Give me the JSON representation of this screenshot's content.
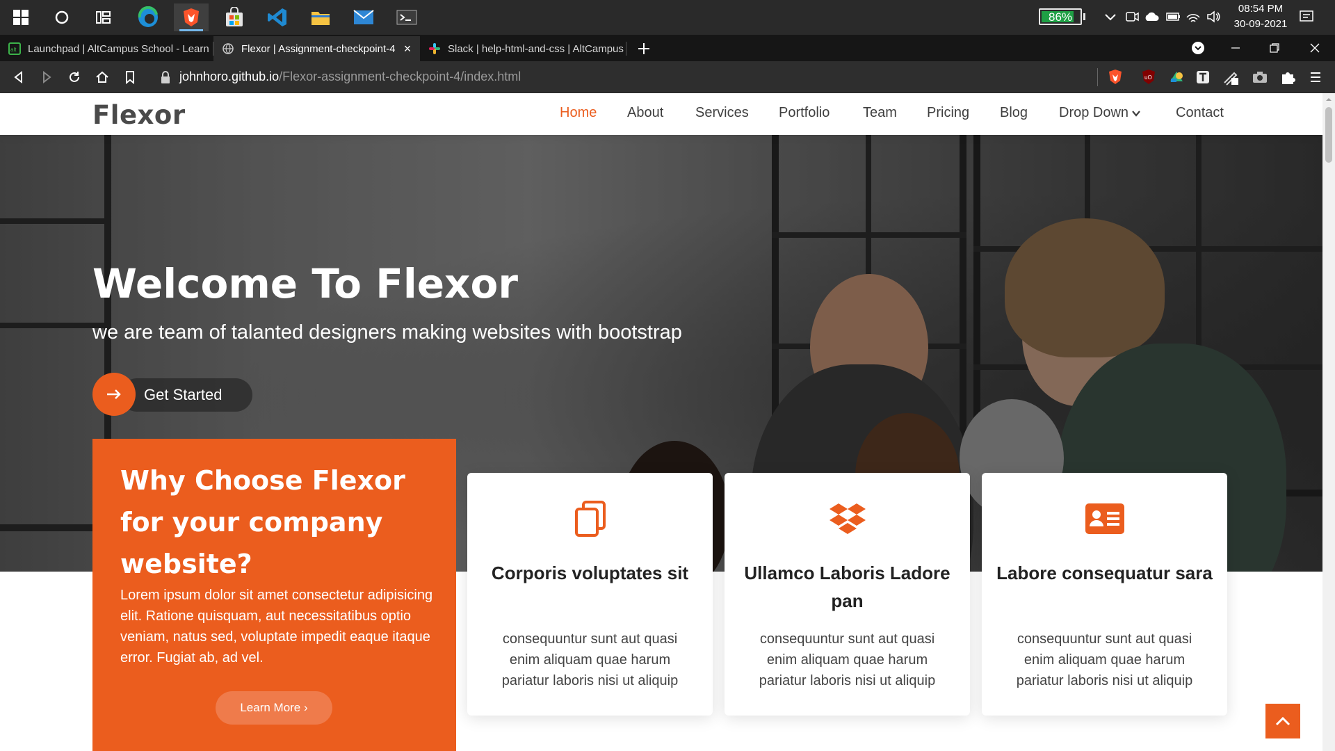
{
  "taskbar": {
    "apps": [
      {
        "name": "windows-start"
      },
      {
        "name": "cortana-search"
      },
      {
        "name": "task-view"
      },
      {
        "name": "edge"
      },
      {
        "name": "brave"
      },
      {
        "name": "microsoft-store"
      },
      {
        "name": "vscode"
      },
      {
        "name": "file-explorer"
      },
      {
        "name": "mail"
      },
      {
        "name": "terminal"
      }
    ],
    "battery_percent": 0.86,
    "battery_label": "86%",
    "clock_time": "08:54 PM",
    "clock_date": "30-09-2021"
  },
  "browser": {
    "tabs": [
      {
        "title": "Launchpad | AltCampus School - Learn",
        "favicon": "altcampus-icon",
        "active": false
      },
      {
        "title": "Flexor | Assignment-checkpoint-4",
        "favicon": "globe-icon",
        "active": true
      },
      {
        "title": "Slack | help-html-and-css | AltCampus",
        "favicon": "slack-icon",
        "active": false
      }
    ],
    "url_host": "johnhoro.github.io",
    "url_path": "/Flexor-assignment-checkpoint-4/index.html"
  },
  "site": {
    "logo": "Flexor",
    "nav": [
      {
        "label": "Home",
        "active": true
      },
      {
        "label": "About"
      },
      {
        "label": "Services"
      },
      {
        "label": "Portfolio"
      },
      {
        "label": "Team"
      },
      {
        "label": "Pricing"
      },
      {
        "label": "Blog"
      },
      {
        "label": "Drop Down"
      },
      {
        "label": "Contact"
      }
    ],
    "hero": {
      "title": "Welcome To Flexor",
      "subtitle": "we are team of talanted designers making websites with bootstrap",
      "cta_label": "Get Started"
    },
    "why": {
      "title": "Why Choose Flexor for your company website?",
      "text": "Lorem ipsum dolor sit amet consectetur adipisicing elit. Ratione quisquam, aut necessitatibus optio veniam, natus sed, voluptate impedit eaque itaque error. Fugiat ab, ad vel.",
      "button_label": "Learn More ›"
    },
    "cards": [
      {
        "icon": "files-icon",
        "title": "Corporis voluptates sit",
        "text": "consequuntur sunt aut quasi enim aliquam quae harum pariatur laboris nisi ut aliquip"
      },
      {
        "icon": "dropbox-icon",
        "title": "Ullamco Laboris Ladore pan",
        "text": "consequuntur sunt aut quasi enim aliquam quae harum pariatur laboris nisi ut aliquip"
      },
      {
        "icon": "id-card-icon",
        "title": "Labore consequatur sara",
        "text": "consequuntur sunt aut quasi enim aliquam quae harum pariatur laboris nisi ut aliquip"
      }
    ]
  },
  "colors": {
    "accent": "#eb5d1e",
    "taskbar_bg": "#2a2a2a",
    "browser_chrome": "#2e2e2e",
    "battery_green": "#1fa045"
  }
}
